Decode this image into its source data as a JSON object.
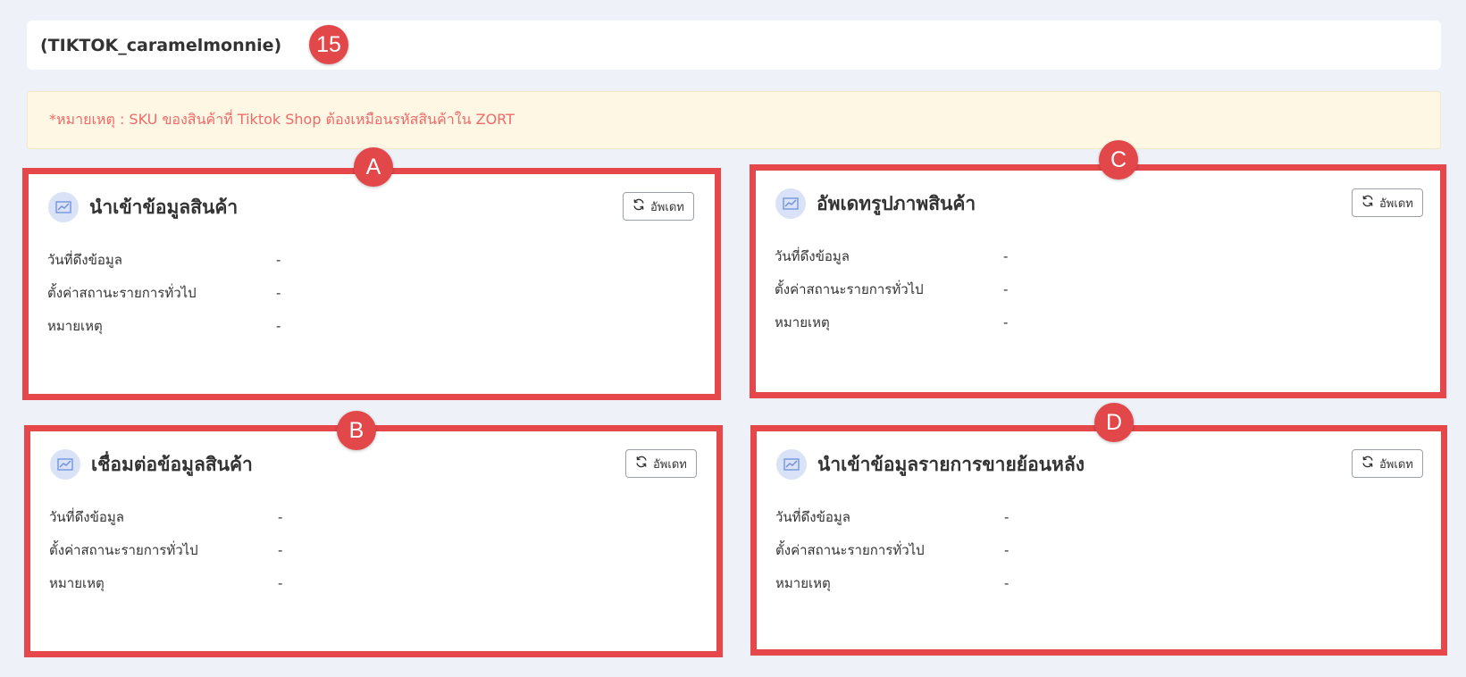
{
  "header": {
    "shop_name": "(TIKTOK_caramelmonnie)",
    "marker": "15"
  },
  "notice": {
    "text": "*หมายเหตุ : SKU ของสินค้าที่ Tiktok Shop ต้องเหมือนรหัสสินค้าใน ZORT"
  },
  "colors": {
    "marker": "#e2474a",
    "highlight_border": "#e5474a",
    "notice_text": "#f06a6a"
  },
  "cards": [
    {
      "marker": "A",
      "title": "นำเข้าข้อมูลสินค้า",
      "button": "อัพเดท",
      "icon": "chart-icon",
      "rows": [
        {
          "label": "วันที่ดึงข้อมูล",
          "value": "-"
        },
        {
          "label": "ตั้งค่าสถานะรายการทั่วไป",
          "value": "-"
        },
        {
          "label": "หมายเหตุ",
          "value": "-"
        }
      ]
    },
    {
      "marker": "B",
      "title": "เชื่อมต่อข้อมูลสินค้า",
      "button": "อัพเดท",
      "icon": "chart-icon",
      "rows": [
        {
          "label": "วันที่ดึงข้อมูล",
          "value": "-"
        },
        {
          "label": "ตั้งค่าสถานะรายการทั่วไป",
          "value": "-"
        },
        {
          "label": "หมายเหตุ",
          "value": "-"
        }
      ]
    },
    {
      "marker": "C",
      "title": "อัพเดทรูปภาพสินค้า",
      "button": "อัพเดท",
      "icon": "chart-icon",
      "rows": [
        {
          "label": "วันที่ดึงข้อมูล",
          "value": "-"
        },
        {
          "label": "ตั้งค่าสถานะรายการทั่วไป",
          "value": "-"
        },
        {
          "label": "หมายเหตุ",
          "value": "-"
        }
      ]
    },
    {
      "marker": "D",
      "title": "นำเข้าข้อมูลรายการขายย้อนหลัง",
      "button": "อัพเดท",
      "icon": "chart-icon",
      "rows": [
        {
          "label": "วันที่ดึงข้อมูล",
          "value": "-"
        },
        {
          "label": "ตั้งค่าสถานะรายการทั่วไป",
          "value": "-"
        },
        {
          "label": "หมายเหตุ",
          "value": "-"
        }
      ]
    }
  ]
}
